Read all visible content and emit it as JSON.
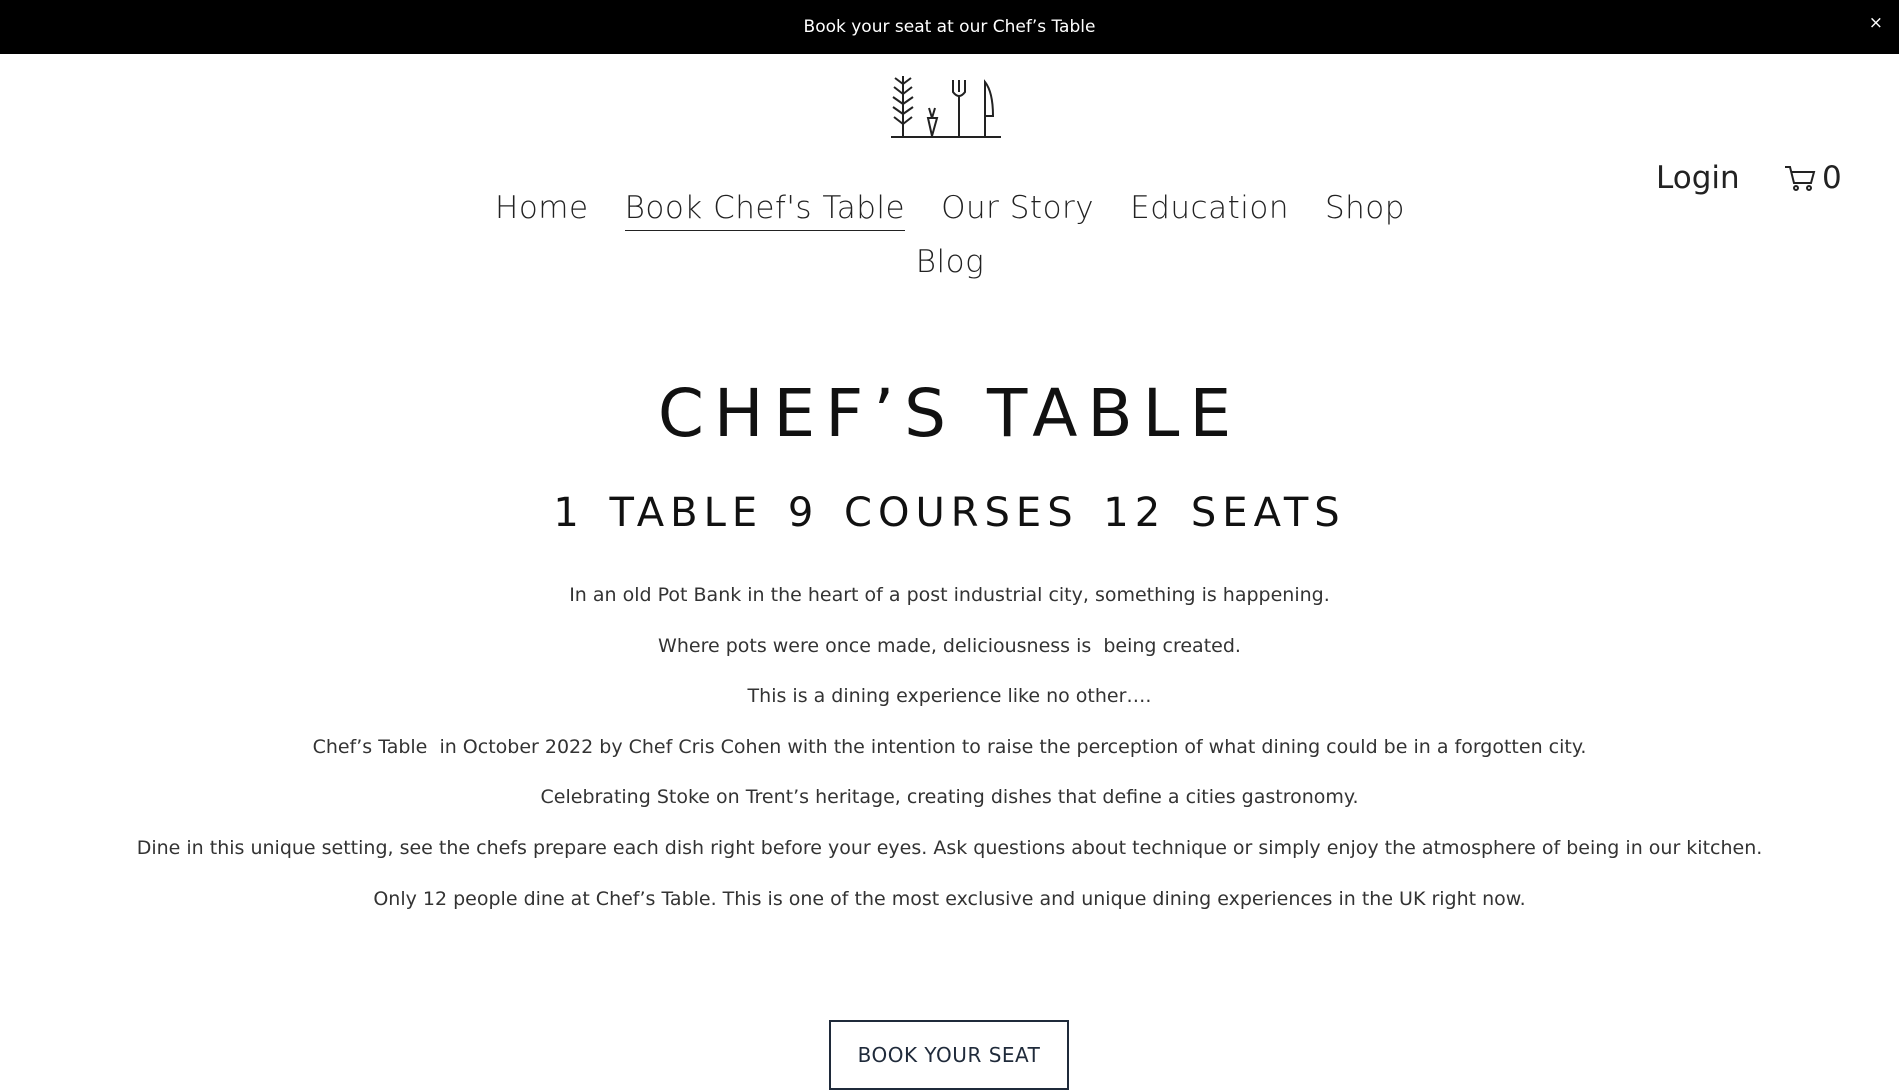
{
  "banner": {
    "text": "Book your seat at our Chef’s Table",
    "close_label": "×"
  },
  "logo": {
    "icon": "herbs-cutlery-logo"
  },
  "nav": {
    "items": [
      {
        "label": "Home"
      },
      {
        "label": "Book Chef's Table"
      },
      {
        "label": "Our Story"
      },
      {
        "label": "Education"
      },
      {
        "label": "Shop"
      },
      {
        "label": "Blog"
      }
    ],
    "active_index": 1
  },
  "account": {
    "login_label": "Login"
  },
  "cart": {
    "icon": "cart-icon",
    "count": "0"
  },
  "main": {
    "title": "CHEF’S TABLE",
    "subtitle": "1 TABLE  9 COURSES  12 SEATS",
    "paragraphs": [
      "In an old Pot Bank in the heart of a post industrial city, something is happening.",
      "Where pots were once made, deliciousness is  being created.",
      "This is a dining experience like no other….",
      "Chef’s Table  in October 2022 by Chef Cris Cohen with the intention to raise the perception of what dining could be in a forgotten city.",
      "Celebrating Stoke on Trent’s heritage, creating dishes that define a cities gastronomy.",
      "Dine in this unique setting, see the chefs prepare each dish right before your eyes. Ask questions about technique or simply enjoy the atmosphere of being in our kitchen.",
      "Only 12 people dine at Chef’s Table. This is one of the most exclusive and unique dining experiences in the UK right now."
    ],
    "cta_label": "BOOK YOUR SEAT"
  },
  "colors": {
    "banner_bg": "#000000",
    "text": "#1f1f1f",
    "button_border": "#1f2a3a"
  }
}
